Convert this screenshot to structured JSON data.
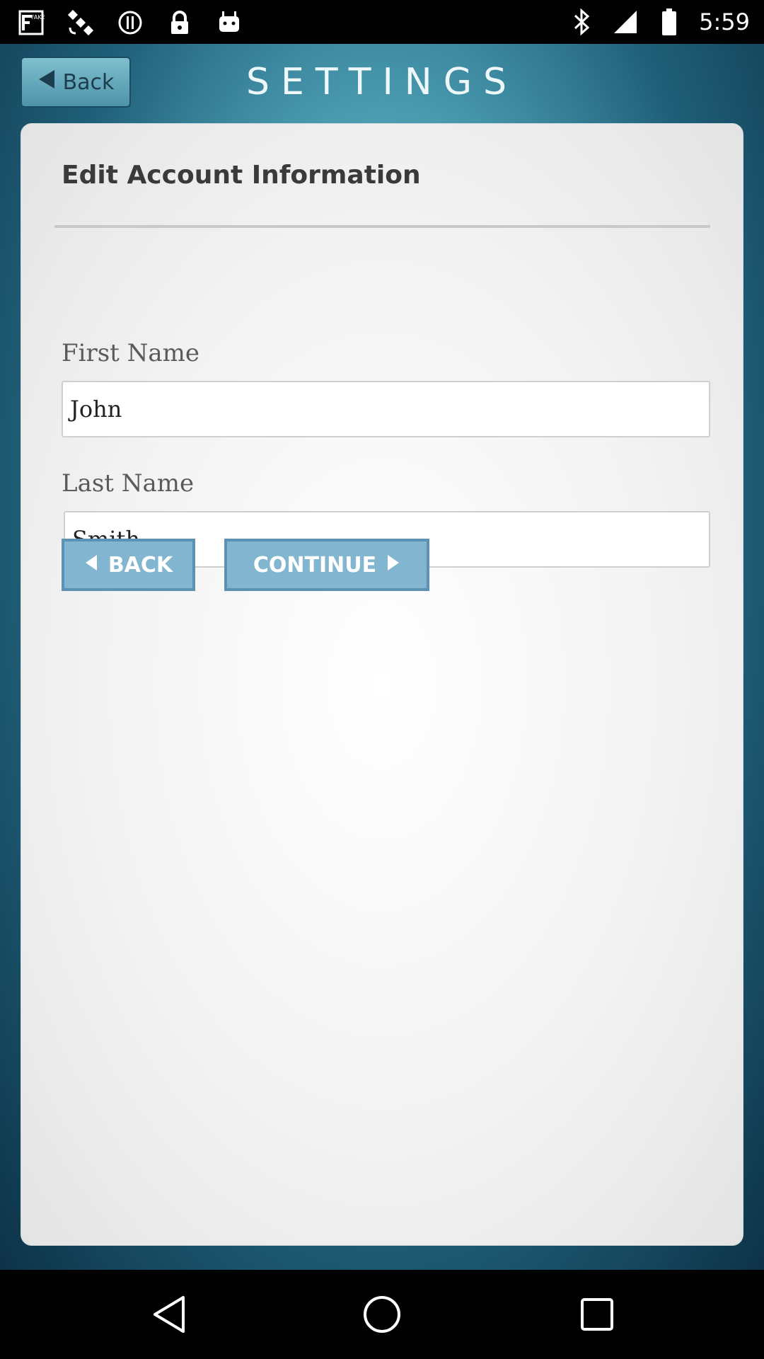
{
  "status_bar": {
    "time": "5:59",
    "left_icons": [
      "fake-gps-icon",
      "satellite-icon",
      "alert-icon",
      "lock-icon",
      "android-icon"
    ],
    "right_icons": [
      "bluetooth-icon",
      "signal-icon",
      "battery-icon"
    ]
  },
  "header": {
    "back_label": "Back",
    "title": "SETTINGS"
  },
  "form": {
    "title": "Edit Account Information",
    "first_name": {
      "label": "First Name",
      "value": "John"
    },
    "last_name": {
      "label": "Last Name",
      "value": "Smith"
    },
    "back_label": "BACK",
    "continue_label": "CONTINUE"
  },
  "nav_bar": {
    "items": [
      "back-icon",
      "home-icon",
      "recents-icon"
    ]
  },
  "colors": {
    "button_fill": "#82b5cf",
    "button_border": "#5c93b4",
    "background_teal": "#4d9fb4"
  }
}
